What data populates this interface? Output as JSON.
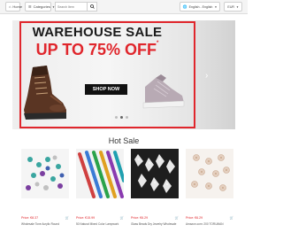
{
  "header": {
    "home_label": "Home",
    "categories_label": "Categories",
    "search_placeholder": "Search Item",
    "language_label": "English - English",
    "currency_label": "EUR"
  },
  "banner": {
    "title": "WAREHOUSE SALE",
    "discount": "UP TO 75% OFF",
    "discount_mark": "*",
    "cta_label": "SHOP NOW",
    "accent_color": "#e0262c",
    "slide_count": 3,
    "active_slide": 2
  },
  "hot_sale": {
    "title": "Hot Sale",
    "products": [
      {
        "price": "Price: €8.37",
        "cart_label": "🛒",
        "name": "Wholesale Tone Acrylic Round"
      },
      {
        "price": "Price: €15.99",
        "cart_label": "🛒",
        "name": "50 Natural Mixed Color Lampwork"
      },
      {
        "price": "Price: €6.29",
        "cart_label": "🛒",
        "name": "Glass Beads Dry Jewelry Wholesale"
      },
      {
        "price": "Price: €6.29",
        "cart_label": "🛒",
        "name": "Amazon.com: 200 TORUMAN"
      }
    ]
  }
}
